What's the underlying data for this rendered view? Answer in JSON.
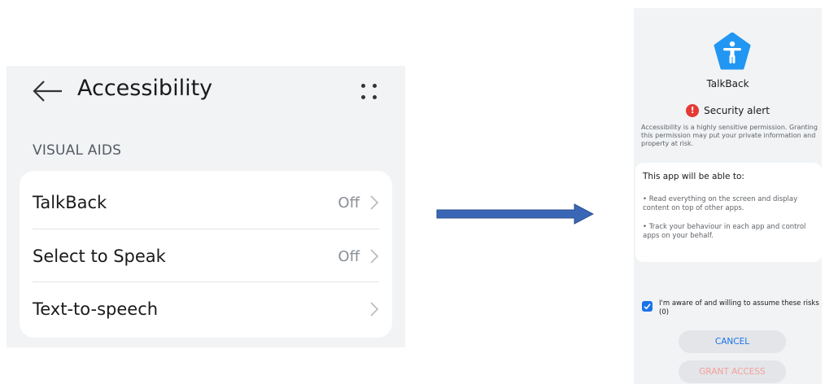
{
  "settings_screen": {
    "title": "Accessibility",
    "section_header": "VISUAL AIDS",
    "items": [
      {
        "label": "TalkBack",
        "value": "Off"
      },
      {
        "label": "Select to Speak",
        "value": "Off"
      },
      {
        "label": "Text-to-speech",
        "value": ""
      }
    ]
  },
  "dialog": {
    "app_name": "TalkBack",
    "app_icon": "accessibility-person-icon",
    "alert_title": "Security alert",
    "alert_icon": "exclamation-icon",
    "alert_description": "Accessibility is a highly sensitive permission. Granting this permission may put your private information and property at risk.",
    "capabilities_title": "This app will be able to:",
    "capabilities": [
      "• Read everything on the screen and display content on top of other apps.",
      "• Track your behaviour in each app and control apps on your behalf."
    ],
    "consent_text": "I'm aware of and willing to assume these risks (0)",
    "consent_checked": true,
    "cancel_label": "CANCEL",
    "grant_label": "GRANT ACCESS"
  },
  "colors": {
    "accent": "#1a73e8",
    "alert": "#e53935",
    "app_icon": "#2196f3",
    "arrow": "#3a67b5"
  }
}
